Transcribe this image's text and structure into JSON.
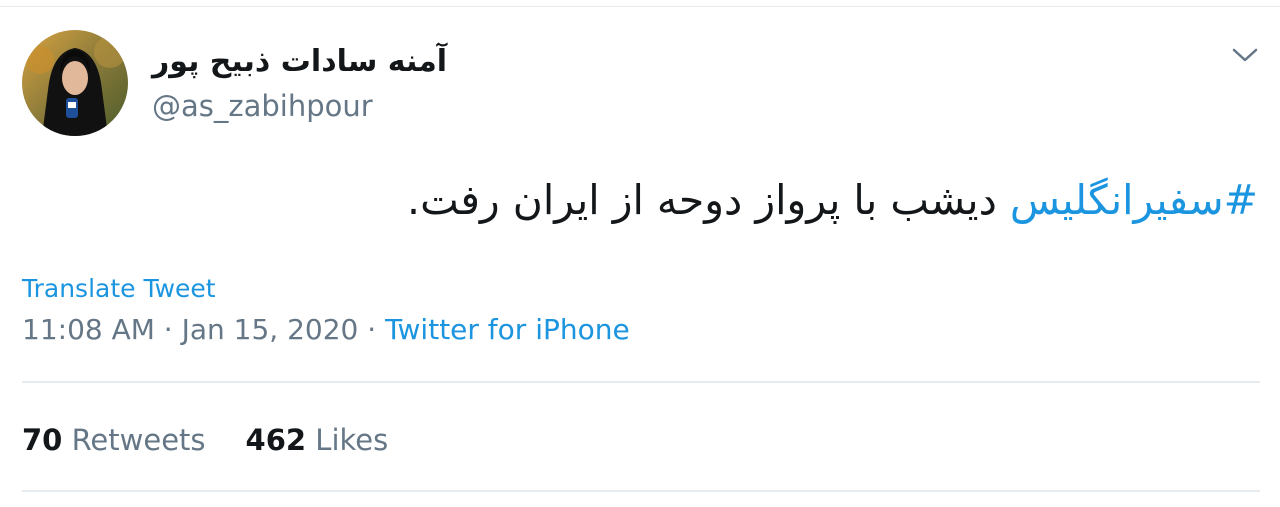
{
  "tweet": {
    "author": {
      "display_name": "آمنه سادات ذبیح پور",
      "handle": "@as_zabihpour"
    },
    "text": {
      "hashtag": "#سفیرانگلیس",
      "body": " دیشب با پرواز دوحه از ایران رفت."
    },
    "translate_label": "Translate Tweet",
    "time": "11:08 AM",
    "separator": " · ",
    "date": "Jan 15, 2020",
    "source": "Twitter for iPhone",
    "stats": {
      "retweets_count": "70",
      "retweets_label": "Retweets",
      "likes_count": "462",
      "likes_label": "Likes"
    }
  },
  "colors": {
    "link": "#1b95e0",
    "muted": "#657786",
    "text": "#14171a",
    "divider": "#e6ecf0"
  },
  "icons": {
    "avatar": "profile-photo",
    "menu": "chevron-down-icon"
  }
}
